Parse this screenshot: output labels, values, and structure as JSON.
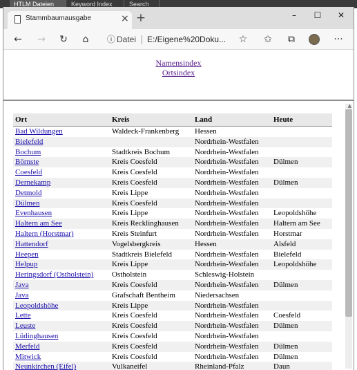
{
  "os_tabs": [
    "HTLM Dateien",
    "Keyword Index",
    "Search"
  ],
  "browser": {
    "tab_title": "Stammbaumausgabe",
    "tab_close": "×",
    "new_tab": "+",
    "window": {
      "minimize": "–",
      "maximize": "☐",
      "close": "✕"
    },
    "toolbar": {
      "back": "←",
      "forward": "→",
      "refresh": "↻",
      "home": "⌂",
      "info": "ⓘ",
      "scheme_label": "Datei",
      "url": "E:/Eigene%20Doku...",
      "favorite": "☆",
      "favorites_bar": "✩",
      "collections": "⧉",
      "more": "···"
    }
  },
  "index_links": [
    "Namensindex",
    "Ortsindex"
  ],
  "table": {
    "headers": [
      "Ort",
      "Kreis",
      "Land",
      "Heute"
    ],
    "rows": [
      [
        "Bad Wildungen",
        "Waldeck-Frankenberg",
        "Hessen",
        ""
      ],
      [
        "Bielefeld",
        "",
        "Nordrhein-Westfalen",
        ""
      ],
      [
        "Bochum",
        "Stadtkreis Bochum",
        "Nordrhein-Westfalen",
        ""
      ],
      [
        "Börnste",
        "Kreis Coesfeld",
        "Nordrhein-Westfalen",
        "Dülmen"
      ],
      [
        "Coesfeld",
        "Kreis Coesfeld",
        "Nordrhein-Westfalen",
        ""
      ],
      [
        "Dernekamp",
        "Kreis Coesfeld",
        "Nordrhein-Westfalen",
        "Dülmen"
      ],
      [
        "Detmold",
        "Kreis Lippe",
        "Nordrhein-Westfalen",
        ""
      ],
      [
        "Dülmen",
        "Kreis Coesfeld",
        "Nordrhein-Westfalen",
        ""
      ],
      [
        "Evenhausen",
        "Kreis Lippe",
        "Nordrhein-Westfalen",
        "Leopoldshöhe"
      ],
      [
        "Haltern am See",
        "Kreis Recklinghausen",
        "Nordrhein-Westfalen",
        "Haltern am See"
      ],
      [
        "Haltern (Horstmar)",
        "Kreis Steinfurt",
        "Nordrhein-Westfalen",
        "Horstmar"
      ],
      [
        "Hattendorf",
        "Vogelsbergkreis",
        "Hessen",
        "Alsfeld"
      ],
      [
        "Heepen",
        "Stadtkreis Bielefeld",
        "Nordrhein-Westfalen",
        "Bielefeld"
      ],
      [
        "Helpup",
        "Kreis Lippe",
        "Nordrhein-Westfalen",
        "Leopoldshöhe"
      ],
      [
        "Heringsdorf (Ostholstein)",
        "Ostholstein",
        "Schleswig-Holstein",
        ""
      ],
      [
        "Java",
        "Kreis Coesfeld",
        "Nordrhein-Westfalen",
        "Dülmen"
      ],
      [
        "Java",
        "Grafschaft Bentheim",
        "Niedersachsen",
        ""
      ],
      [
        "Leopoldshöhe",
        "Kreis Lippe",
        "Nordrhein-Westfalen",
        ""
      ],
      [
        "Lette",
        "Kreis Coesfeld",
        "Nordrhein-Westfalen",
        "Coesfeld"
      ],
      [
        "Leuste",
        "Kreis Coesfeld",
        "Nordrhein-Westfalen",
        "Dülmen"
      ],
      [
        "Lüdinghausen",
        "Kreis Coesfeld",
        "Nordrhein-Westfalen",
        ""
      ],
      [
        "Merfeld",
        "Kreis Coesfeld",
        "Nordrhein-Westfalen",
        "Dülmen"
      ],
      [
        "Mitwick",
        "Kreis Coesfeld",
        "Nordrhein-Westfalen",
        "Dülmen"
      ],
      [
        "Neunkirchen (Eifel)",
        "Vulkaneifel",
        "Rheinland-Pfalz",
        "Daun"
      ]
    ]
  }
}
